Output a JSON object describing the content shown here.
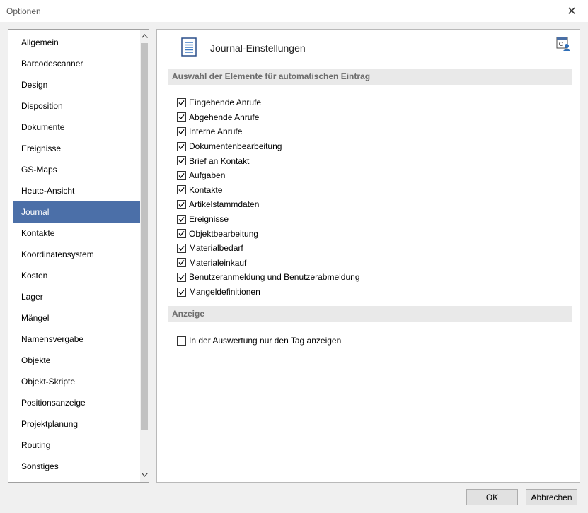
{
  "window": {
    "title": "Optionen"
  },
  "nav": {
    "items": [
      {
        "label": "Allgemein"
      },
      {
        "label": "Barcodescanner"
      },
      {
        "label": "Design"
      },
      {
        "label": "Disposition"
      },
      {
        "label": "Dokumente"
      },
      {
        "label": "Ereignisse"
      },
      {
        "label": "GS-Maps"
      },
      {
        "label": "Heute-Ansicht"
      },
      {
        "label": "Journal"
      },
      {
        "label": "Kontakte"
      },
      {
        "label": "Koordinatensystem"
      },
      {
        "label": "Kosten"
      },
      {
        "label": "Lager"
      },
      {
        "label": "Mängel"
      },
      {
        "label": "Namensvergabe"
      },
      {
        "label": "Objekte"
      },
      {
        "label": "Objekt-Skripte"
      },
      {
        "label": "Positionsanzeige"
      },
      {
        "label": "Projektplanung"
      },
      {
        "label": "Routing"
      },
      {
        "label": "Sonstiges"
      }
    ],
    "selected": "Journal"
  },
  "content": {
    "title": "Journal-Einstellungen",
    "section1": "Auswahl der Elemente für automatischen Eintrag",
    "checkboxes": [
      {
        "label": "Eingehende Anrufe",
        "checked": true
      },
      {
        "label": "Abgehende Anrufe",
        "checked": true
      },
      {
        "label": "Interne Anrufe",
        "checked": true
      },
      {
        "label": "Dokumentenbearbeitung",
        "checked": true
      },
      {
        "label": "Brief an Kontakt",
        "checked": true
      },
      {
        "label": "Aufgaben",
        "checked": true
      },
      {
        "label": "Kontakte",
        "checked": true
      },
      {
        "label": "Artikelstammdaten",
        "checked": true
      },
      {
        "label": "Ereignisse",
        "checked": true
      },
      {
        "label": "Objektbearbeitung",
        "checked": true
      },
      {
        "label": "Materialbedarf",
        "checked": true
      },
      {
        "label": "Materialeinkauf",
        "checked": true
      },
      {
        "label": "Benutzeranmeldung und Benutzerabmeldung",
        "checked": true
      },
      {
        "label": "Mangeldefinitionen",
        "checked": true
      }
    ],
    "section2": "Anzeige",
    "display_option": {
      "label": "In der Auswertung nur den Tag anzeigen",
      "checked": false
    }
  },
  "buttons": {
    "ok": "OK",
    "cancel": "Abbrechen"
  },
  "colors": {
    "selected": "#4b6fa8",
    "section_bg": "#e9e9e9",
    "section_text": "#6d6d6d"
  }
}
